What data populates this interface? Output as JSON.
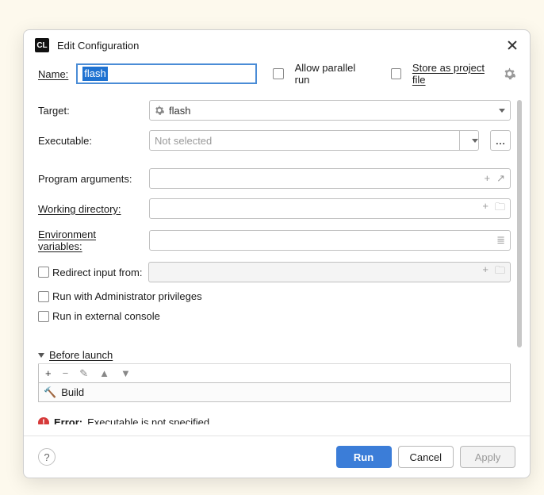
{
  "dialog": {
    "title": "Edit Configuration",
    "name_label": "Name:",
    "name_value": "flash",
    "allow_parallel_label": "Allow parallel run",
    "store_project_label": "Store as project file"
  },
  "form": {
    "target_label": "Target:",
    "target_value": "flash",
    "executable_label": "Executable:",
    "executable_placeholder": "Not selected",
    "program_args_label": "Program arguments:",
    "working_dir_label": "Working directory:",
    "env_vars_label": "Environment variables:",
    "redirect_input_label": "Redirect input from:",
    "admin_label": "Run with Administrator privileges",
    "external_console_label": "Run in external console"
  },
  "before_launch": {
    "title": "Before launch",
    "item": "Build"
  },
  "error": {
    "label": "Error:",
    "message": "Executable is not specified"
  },
  "buttons": {
    "run": "Run",
    "cancel": "Cancel",
    "apply": "Apply"
  }
}
